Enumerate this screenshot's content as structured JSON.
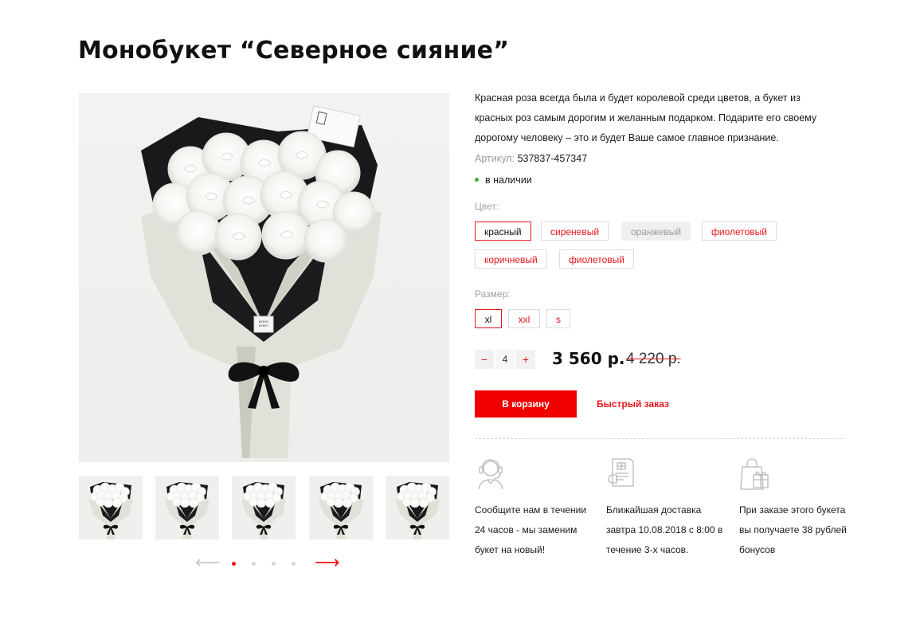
{
  "product": {
    "title": "Монобукет “Северное сияние”",
    "description": "Красная роза всегда была и будет королевой среди цветов, а букет из красных роз самым дорогим и желанным подарком. Подарите его своему дорогому человеку – это и будет Ваше самое главное признание.",
    "sku_label": "Артикул:",
    "sku_value": "537837-457347",
    "stock": "в наличии",
    "package_tag": "МОНО БУКЕТ"
  },
  "color_option": {
    "label": "Цвет:",
    "options": [
      {
        "label": "красный",
        "state": "selected"
      },
      {
        "label": "сиреневый",
        "state": "normal"
      },
      {
        "label": "оранжевый",
        "state": "disabled"
      },
      {
        "label": "фиолетовый",
        "state": "normal"
      },
      {
        "label": "коричневый",
        "state": "normal"
      },
      {
        "label": "фиолетовый",
        "state": "normal"
      }
    ]
  },
  "size_option": {
    "label": "Размер:",
    "options": [
      {
        "label": "xl",
        "state": "selected"
      },
      {
        "label": "xxl",
        "state": "normal"
      },
      {
        "label": "s",
        "state": "normal"
      }
    ]
  },
  "purchase": {
    "qty_minus": "−",
    "qty_value": "4",
    "qty_plus": "+",
    "price": "3 560 р.",
    "old_price": "4 220 р.",
    "cart_button": "В корзину",
    "quick_order": "Быстрый заказ"
  },
  "gallery": {
    "thumbnail_count": 5,
    "prev_arrow": "⟵",
    "next_arrow": "⟶",
    "dots": 4,
    "active_dot": 0
  },
  "features": [
    {
      "icon": "headset-operator-icon",
      "text": "Сообщите нам в течении 24 часов - мы заменим букет на новый!"
    },
    {
      "icon": "delivery-document-icon",
      "text": "Ближайшая доставка завтра 10.08.2018 с 8:00 в течение 3-х часов."
    },
    {
      "icon": "gift-bag-icon",
      "text": "При заказе этого букета вы получаете 38 рублей бонусов"
    }
  ],
  "colors": {
    "accent": "#e8161b",
    "button": "#f00000",
    "in_stock": "#3cb043",
    "icon_line": "#b9b9b9"
  }
}
